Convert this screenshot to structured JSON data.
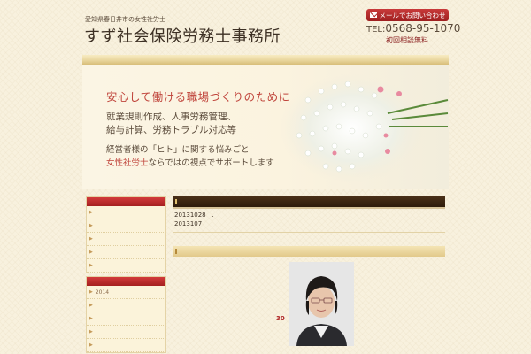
{
  "header": {
    "tagline": "愛知県春日井市の女性社労士",
    "title": "すず社会保険労務士事務所",
    "contact_label": "メールでお問い合わせ",
    "tel_prefix": "TEL:",
    "tel_number": "0568-95-1070",
    "consult": "初回相談無料"
  },
  "hero": {
    "line1": "安心して働ける職場づくりのために",
    "line2": "就業規則作成、人事労務管理、",
    "line3": "給与計算、労務トラブル対応等",
    "line4": "経営者様の「ヒト」に関する悩みごと",
    "line5_highlight": "女性社労士",
    "line5_rest": "ならではの視点でサポートします"
  },
  "sidebar": {
    "box1_items": [
      "",
      "",
      "",
      "",
      ""
    ],
    "box2_items": [
      "2014",
      "",
      "",
      "",
      ""
    ]
  },
  "news": {
    "line1_date": "20131028",
    "line1_text": ".",
    "line2_date": "2013107"
  },
  "profile": {
    "number": "30"
  }
}
